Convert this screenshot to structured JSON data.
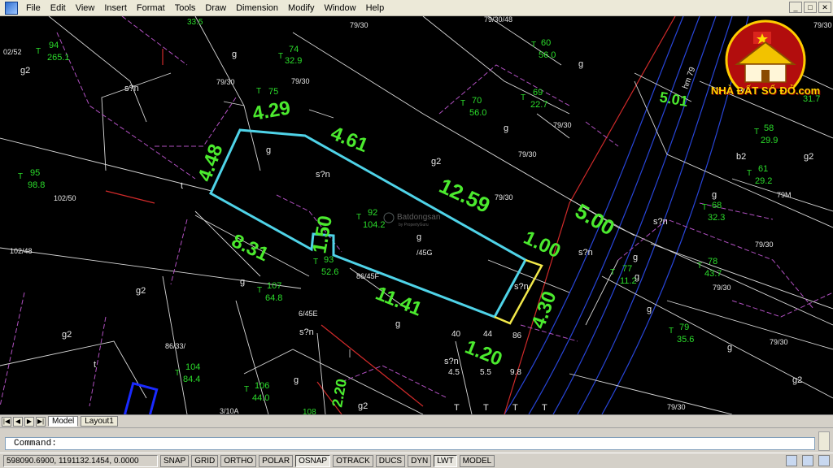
{
  "menu": [
    "File",
    "Edit",
    "View",
    "Insert",
    "Format",
    "Tools",
    "Draw",
    "Dimension",
    "Modify",
    "Window",
    "Help"
  ],
  "window_controls": [
    "_",
    "□",
    "✕"
  ],
  "logo": {
    "text": "NHÀ ĐẤT SỔ ĐỎ.com"
  },
  "watermark": {
    "brand": "Batdongsan",
    "sub": "by PropertyGuru"
  },
  "dimensions": {
    "d429": "4.29",
    "d461": "4.61",
    "d448": "4.48",
    "d1259": "12.59",
    "d500": "5.00",
    "d100": "1.00",
    "d150": "1.50",
    "d831": "8.31",
    "d1141": "11.41",
    "d430": "4.30",
    "d120": "1.20",
    "d220": "2.20",
    "d501": "5.01"
  },
  "parcels": [
    {
      "id": "p94",
      "t": "T",
      "num": "94",
      "area": "265.1"
    },
    {
      "id": "p74",
      "t": "T",
      "num": "74",
      "area": "32.9"
    },
    {
      "id": "p75",
      "t": "T",
      "num": "75",
      "area": "..."
    },
    {
      "id": "p60",
      "t": "T",
      "num": "60",
      "area": "56.0"
    },
    {
      "id": "p69",
      "t": "T",
      "num": "69",
      "area": "22.7"
    },
    {
      "id": "p70",
      "t": "T",
      "num": "70",
      "area": "56.0"
    },
    {
      "id": "p58",
      "t": "T",
      "num": "58",
      "area": "29.9"
    },
    {
      "id": "p61",
      "t": "T",
      "num": "61",
      "area": "29.2"
    },
    {
      "id": "p68",
      "t": "T",
      "num": "68",
      "area": "32.3"
    },
    {
      "id": "p95",
      "t": "T",
      "num": "95",
      "area": "98.8"
    },
    {
      "id": "p92",
      "t": "T",
      "num": "92",
      "area": "104.2"
    },
    {
      "id": "p93",
      "t": "T",
      "num": "93",
      "area": "52.6"
    },
    {
      "id": "p107",
      "t": "T",
      "num": "107",
      "area": "64.8"
    },
    {
      "id": "p77",
      "t": "T",
      "num": "77",
      "area": "11.2"
    },
    {
      "id": "p78",
      "t": "T",
      "num": "78",
      "area": "43.7"
    },
    {
      "id": "p79",
      "t": "T",
      "num": "79",
      "area": "35.6"
    },
    {
      "id": "p104",
      "t": "T",
      "num": "104",
      "area": "84.4"
    },
    {
      "id": "p106",
      "t": "T",
      "num": "106",
      "area": "44.0"
    },
    {
      "id": "p31",
      "t": "",
      "num": "...",
      "area": "31.7"
    }
  ],
  "addresses": {
    "a1": "02/52",
    "a2": "79/30",
    "a3": "79/30/48",
    "a4": "79/30",
    "a5": "79/30",
    "a6": "79/30",
    "a7": "79/30",
    "a8": "102/50",
    "a9": "102/48",
    "a10": "79/30",
    "a11": "79M",
    "a12": "79/30",
    "a13": "86/45F",
    "a14": "6/45E",
    "a15": "86/33/",
    "a16": "79/30",
    "a17": "79/30",
    "a18": "79/30",
    "a19": "3/10A",
    "a20": "/45G",
    "a21": "79/30",
    "a22": "hm 79"
  },
  "land_codes": {
    "g2a": "g2",
    "g1": "g",
    "sn1": "s?n",
    "g2": "g",
    "g3": "g",
    "g4": "g",
    "b2a": "b2",
    "b2b": "b2",
    "g5": "g",
    "g2b": "g2",
    "g6": "g",
    "sn2": "s?n",
    "sn3": "s?n",
    "sn4": "s?n",
    "g7": "g",
    "g2c": "g2",
    "g8": "g",
    "g2d": "g2",
    "t1": "t",
    "g9": "g",
    "sn5": "s?n",
    "sn6": "s?n",
    "g10": "g",
    "g2e": "g2",
    "g11": "g",
    "g12": "g",
    "g13": "g",
    "g2f": "g2",
    "g2g": "g2",
    "t2": "t",
    "sn7": "s?n",
    "t3": "T",
    "t4": "T",
    "t5": "T",
    "t6": "T"
  },
  "small_numbers": {
    "n40": "40",
    "n44": "44",
    "n86": "86",
    "n45": "4.5",
    "n55": "5.5",
    "n98": "9.8",
    "n108": "108",
    "n33": "33.5"
  },
  "tabs": [
    "Model",
    "Layout1"
  ],
  "tab_nav": [
    "|◀",
    "◀",
    "▶",
    "▶|"
  ],
  "command": {
    "prompt": "Command:"
  },
  "status": {
    "coords": "598090.6900, 1191132.1454, 0.0000",
    "toggles": [
      "SNAP",
      "GRID",
      "ORTHO",
      "POLAR",
      "OSNAP",
      "OTRACK",
      "DUCS",
      "DYN",
      "LWT",
      "MODEL"
    ],
    "toggles_on": [
      "OSNAP",
      "LWT"
    ]
  },
  "colors": {
    "canvas": "#000000",
    "lot_outline": "#4fd3e8",
    "frontage": "#f2e84a",
    "dim_text": "#4bea2e",
    "parcel_line": "#b050c0",
    "road": "#2845d8",
    "boundary": "#d02a2a"
  }
}
